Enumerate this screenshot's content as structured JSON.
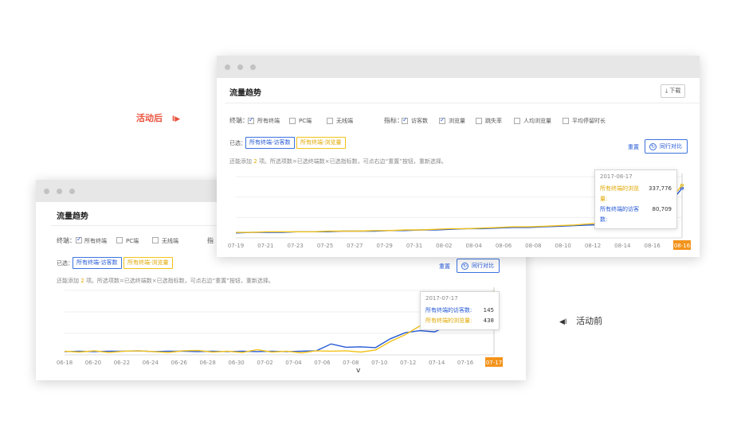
{
  "colors": {
    "visitor": "#2458d6",
    "pageview": "#f2c21b",
    "accent_red": "#e9503a",
    "end_tick": "#f3931b"
  },
  "labels": {
    "after": "活动后",
    "before": "活动前"
  },
  "after_window": {
    "title": "流量趋势",
    "download": "下载",
    "terminal_label": "终端：",
    "terminals": [
      "所有终端",
      "PC端",
      "无线端"
    ],
    "metric_label": "指标：",
    "metrics": [
      "访客数",
      "浏览量",
      "跳失率",
      "人均浏览量",
      "平均停留时长"
    ],
    "selected_label": "已选：",
    "selected": [
      "所有终端-访客数",
      "所有终端-浏览量"
    ],
    "reset": "重置",
    "compare": "同行对比",
    "hint_prefix": "还能添加",
    "hint_count": "2",
    "hint_suffix": "项。所选项数=已选终端数×已选指标数，可点右边“重置”按钮，重新选择。",
    "tooltip": {
      "date": "2017-08-17",
      "pageview_label": "所有终端的浏览量:",
      "pageview_value": "337,776",
      "visitor_label": "所有终端的访客数:",
      "visitor_value": "80,709"
    }
  },
  "before_window": {
    "title": "流量趋势",
    "terminal_label": "终端：",
    "terminals": [
      "所有终端",
      "PC端",
      "无线端"
    ],
    "metric_label": "指",
    "selected_label": "已选：",
    "selected": [
      "所有终端-访客数",
      "所有终端-浏览量"
    ],
    "reset": "重置",
    "compare": "同行对比",
    "hint_prefix": "还能添加",
    "hint_count": "2",
    "hint_suffix": "项。所选项数=已选终端数×已选指标数，可点右边“重置”按钮，重新选择。",
    "tooltip": {
      "date": "2017-07-17",
      "visitor_label": "所有终端的访客数:",
      "visitor_value": "145",
      "pageview_label": "所有终端的浏览量:",
      "pageview_value": "438"
    },
    "cursor_char": "v"
  },
  "chart_data": [
    {
      "type": "line",
      "x": [
        "07-19",
        "07-20",
        "07-21",
        "07-22",
        "07-23",
        "07-24",
        "07-25",
        "07-26",
        "07-27",
        "07-28",
        "07-29",
        "07-30",
        "07-31",
        "08-01",
        "08-02",
        "08-03",
        "08-04",
        "08-05",
        "08-06",
        "08-07",
        "08-08",
        "08-09",
        "08-10",
        "08-11",
        "08-12",
        "08-13",
        "08-14",
        "08-15",
        "08-16",
        "08-17"
      ],
      "tick_labels": [
        "07-19",
        "07-21",
        "07-23",
        "07-25",
        "07-27",
        "07-29",
        "07-31",
        "08-02",
        "08-04",
        "08-06",
        "08-08",
        "08-10",
        "08-12",
        "08-14",
        "08-16",
        "08-16"
      ],
      "series": [
        {
          "name": "所有终端-访客数",
          "values": [
            8,
            9,
            9,
            9,
            10,
            10,
            10,
            11,
            11,
            11,
            12,
            12,
            13,
            13,
            14,
            15,
            15,
            16,
            17,
            17,
            18,
            19,
            20,
            21,
            22,
            24,
            26,
            30,
            50,
            81
          ]
        },
        {
          "name": "所有终端-浏览量",
          "values": [
            9,
            9,
            10,
            10,
            10,
            10,
            11,
            11,
            11,
            12,
            12,
            13,
            13,
            14,
            15,
            15,
            16,
            17,
            18,
            18,
            19,
            20,
            21,
            23,
            24,
            25,
            28,
            33,
            55,
            86
          ]
        }
      ],
      "ylim": [
        0,
        100
      ],
      "grid": true
    },
    {
      "type": "line",
      "x": [
        "06-18",
        "06-19",
        "06-20",
        "06-21",
        "06-22",
        "06-23",
        "06-24",
        "06-25",
        "06-26",
        "06-27",
        "06-28",
        "06-29",
        "06-30",
        "07-01",
        "07-02",
        "07-03",
        "07-04",
        "07-05",
        "07-06",
        "07-07",
        "07-08",
        "07-09",
        "07-10",
        "07-11",
        "07-12",
        "07-13",
        "07-14",
        "07-15",
        "07-16",
        "07-17"
      ],
      "tick_labels": [
        "06-18",
        "06-20",
        "06-22",
        "06-24",
        "06-26",
        "06-28",
        "06-30",
        "07-02",
        "07-04",
        "07-06",
        "07-08",
        "07-10",
        "07-12",
        "07-14",
        "07-16",
        "07-17"
      ],
      "series": [
        {
          "name": "所有终端-访客数",
          "values": [
            8,
            9,
            8,
            9,
            9,
            10,
            8,
            9,
            9,
            8,
            9,
            8,
            9,
            8,
            9,
            8,
            9,
            10,
            27,
            19,
            20,
            18,
            40,
            55,
            60,
            57,
            75,
            82,
            90,
            145
          ]
        },
        {
          "name": "所有终端-浏览量",
          "values": [
            9,
            7,
            10,
            6,
            9,
            10,
            8,
            6,
            10,
            11,
            7,
            9,
            6,
            13,
            7,
            9,
            5,
            10,
            9,
            10,
            7,
            12,
            33,
            50,
            72,
            63,
            81,
            90,
            100,
            438
          ]
        }
      ],
      "ylim": [
        0,
        160
      ],
      "grid": true
    }
  ]
}
